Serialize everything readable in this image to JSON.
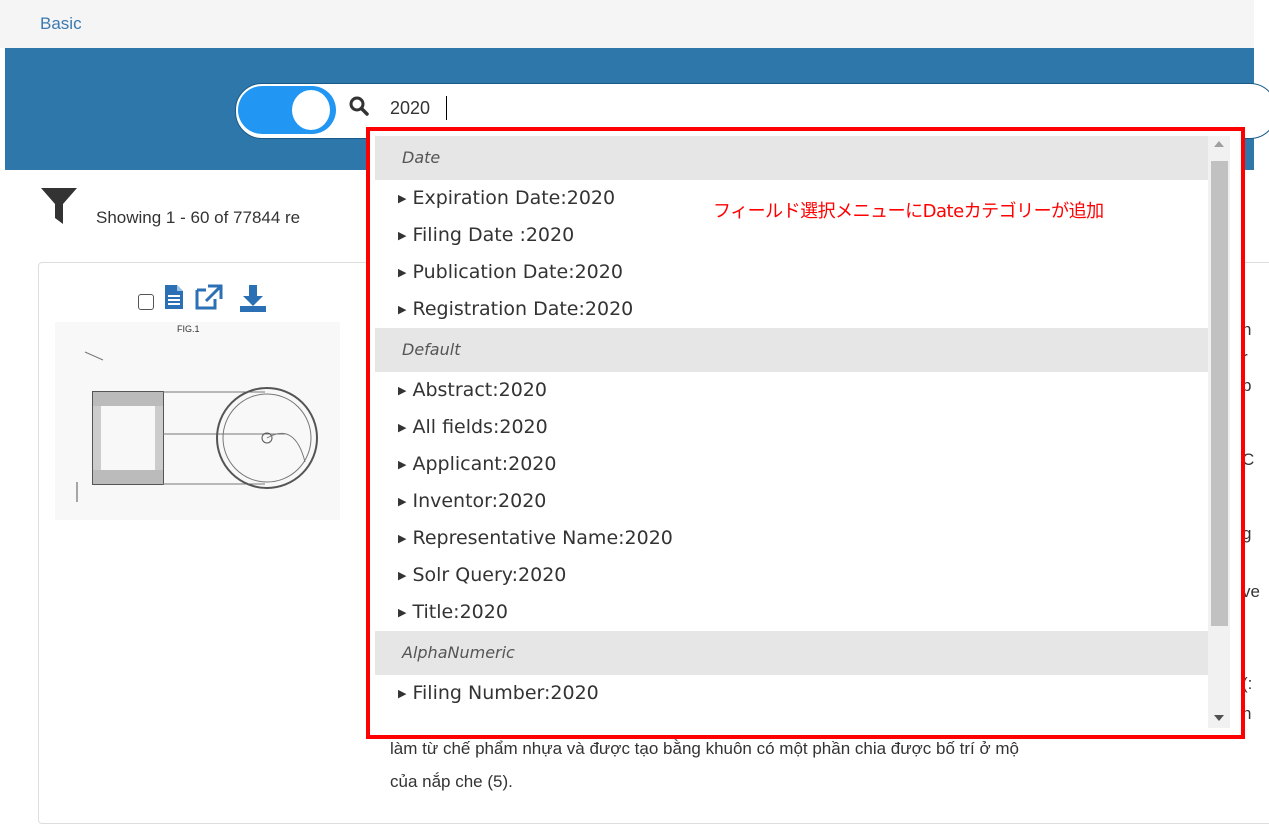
{
  "header": {
    "tab_basic": "Basic"
  },
  "search": {
    "value": "2020"
  },
  "results": {
    "showing_text": "Showing 1 - 60 of 77844 re"
  },
  "dropdown": {
    "annotation": "フィールド選択メニューにDateカテゴリーが追加",
    "categories": [
      {
        "label": "Date",
        "items": [
          "Expiration Date:2020",
          "Filing Date :2020",
          "Publication Date:2020",
          "Registration Date:2020"
        ]
      },
      {
        "label": "Default",
        "items": [
          "Abstract:2020",
          "All fields:2020",
          "Applicant:2020",
          "Inventor:2020",
          "Representative Name:2020",
          "Solr Query:2020",
          "Title:2020"
        ]
      },
      {
        "label": "AlphaNumeric",
        "items": [
          "Filing Number:2020"
        ]
      }
    ]
  },
  "card": {
    "figure_label": "FIG.1",
    "body_lines": [
      "làm từ chế phẩm nhựa và được tạo bằng khuôn có một phần chia được bố trí ở mộ",
      "của nắp che (5)."
    ],
    "clipped_right": [
      "n",
      "r",
      "b",
      "C",
      "g",
      "ve",
      "(:",
      "n"
    ]
  },
  "icons": {
    "filter": "filter-icon",
    "search": "search-icon",
    "document": "document-icon",
    "external_link": "external-link-icon",
    "download": "download-icon"
  },
  "colors": {
    "header_blue": "#2e77aa",
    "toggle_blue": "#2196f3",
    "highlight_red": "#ff0000",
    "tool_blue": "#2b6fb5"
  }
}
